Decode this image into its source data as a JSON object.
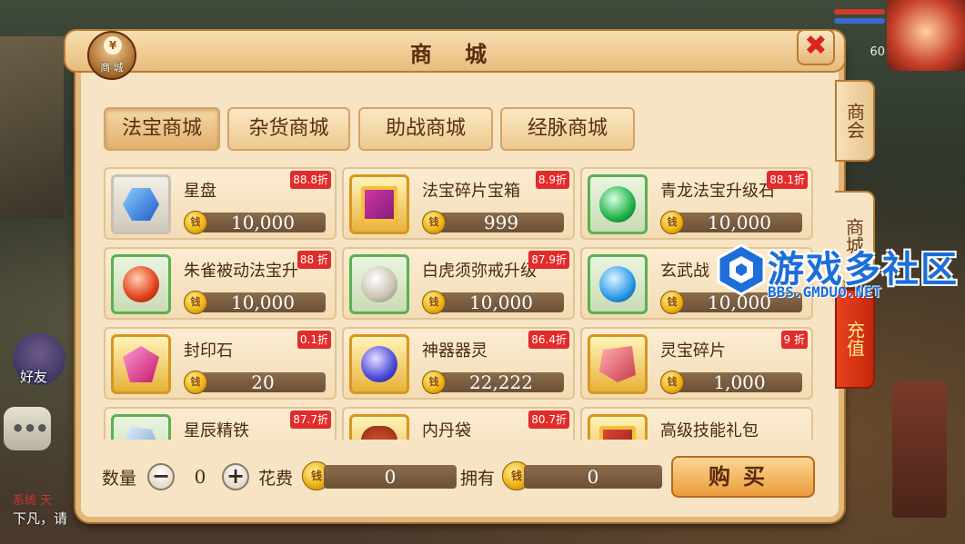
{
  "shop": {
    "title": "商 城",
    "badge_label": "商 城",
    "badge_icon": "¥",
    "close_icon": "✖"
  },
  "side_tabs": [
    {
      "label": "商会"
    },
    {
      "label": "商城"
    },
    {
      "label": "充值"
    }
  ],
  "categories": [
    {
      "label": "法宝商城",
      "active": true
    },
    {
      "label": "杂货商城",
      "active": false
    },
    {
      "label": "助战商城",
      "active": false
    },
    {
      "label": "经脉商城",
      "active": false
    }
  ],
  "items": [
    {
      "name": "星盘",
      "discount": "88.8折",
      "price": "10,000",
      "frame": "gray",
      "gem": "blue-hex"
    },
    {
      "name": "法宝碎片宝箱",
      "discount": "8.9折",
      "price": "999",
      "frame": "gold",
      "gem": "gift-box"
    },
    {
      "name": "青龙法宝升级石",
      "discount": "88.1折",
      "price": "10,000",
      "frame": "green",
      "gem": "green-orb"
    },
    {
      "name": "朱雀被动法宝升",
      "discount": "88 折",
      "price": "10,000",
      "frame": "green",
      "gem": "red-orb"
    },
    {
      "name": "白虎须弥戒升级",
      "discount": "87.9折",
      "price": "10,000",
      "frame": "green",
      "gem": "white-orb"
    },
    {
      "name": "玄武战",
      "discount": "",
      "price": "10,000",
      "frame": "green",
      "gem": "blue-orb"
    },
    {
      "name": "封印石",
      "discount": "0.1折",
      "price": "20",
      "frame": "gold",
      "gem": "pink-crystal"
    },
    {
      "name": "神器器灵",
      "discount": "86.4折",
      "price": "22,222",
      "frame": "gold",
      "gem": "purple-orb"
    },
    {
      "name": "灵宝碎片",
      "discount": "9 折",
      "price": "1,000",
      "frame": "gold",
      "gem": "red-shard"
    },
    {
      "name": "星辰精铁",
      "discount": "87.7折",
      "price": "",
      "frame": "green",
      "gem": "silver-ore"
    },
    {
      "name": "内丹袋",
      "discount": "80.7折",
      "price": "",
      "frame": "gold",
      "gem": "pouch"
    },
    {
      "name": "高级技能礼包",
      "discount": "",
      "price": "",
      "frame": "gold",
      "gem": "red-gift"
    }
  ],
  "coin_icon": "钱",
  "bottom": {
    "quantity_label": "数量",
    "quantity_value": "0",
    "minus_icon": "−",
    "plus_icon": "+",
    "cost_label": "花费",
    "cost_value": "0",
    "owned_label": "拥有",
    "owned_value": "0",
    "buy_label": "购买"
  },
  "background": {
    "friend_label": "好友",
    "chat_dots": "•••",
    "chat_line1": "系统 天",
    "chat_line2": "下凡，请",
    "level": "60"
  },
  "watermark": {
    "title": "游戏多社区",
    "url": "BBS.GMDUO.NET"
  },
  "colors": {
    "panel_bg": "#f6e4c4",
    "discount_red": "#e22b2b",
    "recharge_tab": "#d8361a",
    "watermark_blue": "#1c6ed8"
  }
}
